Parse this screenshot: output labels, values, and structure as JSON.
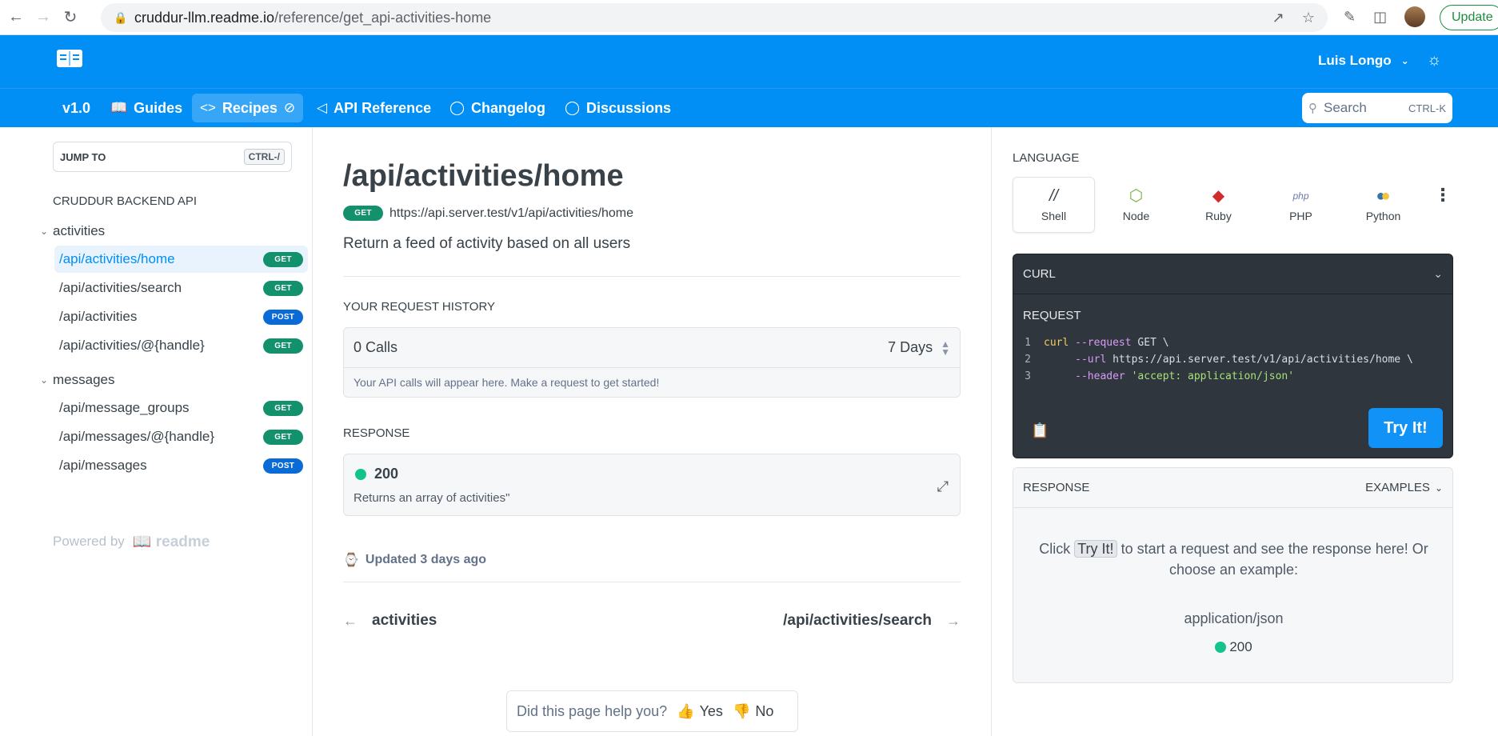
{
  "browser": {
    "url_host": "cruddur-llm.readme.io",
    "url_path": "/reference/get_api-activities-home",
    "update_label": "Update"
  },
  "header": {
    "user_name": "Luis Longo"
  },
  "nav": {
    "version": "v1.0",
    "items": [
      {
        "label": "Guides",
        "icon": "book-icon"
      },
      {
        "label": "Recipes",
        "icon": "code-icon"
      },
      {
        "label": "API Reference",
        "icon": "megaphone-icon"
      },
      {
        "label": "Changelog",
        "icon": "chat-icon"
      },
      {
        "label": "Discussions",
        "icon": "chat-icon"
      }
    ],
    "search_placeholder": "Search",
    "search_shortcut": "CTRL-K"
  },
  "sidebar": {
    "jump_to": "JUMP TO",
    "jump_shortcut": "CTRL-/",
    "title": "CRUDDUR BACKEND API",
    "sections": [
      {
        "name": "activities",
        "items": [
          {
            "label": "/api/activities/home",
            "method": "GET",
            "active": true
          },
          {
            "label": "/api/activities/search",
            "method": "GET"
          },
          {
            "label": "/api/activities",
            "method": "POST"
          },
          {
            "label": "/api/activities/@{handle}",
            "method": "GET"
          }
        ]
      },
      {
        "name": "messages",
        "items": [
          {
            "label": "/api/message_groups",
            "method": "GET"
          },
          {
            "label": "/api/messages/@{handle}",
            "method": "GET"
          },
          {
            "label": "/api/messages",
            "method": "POST"
          }
        ]
      }
    ],
    "powered_by": "Powered by",
    "powered_brand": "readme"
  },
  "main": {
    "title": "/api/activities/home",
    "method": "GET",
    "url": "https://api.server.test/v1/api/activities/home",
    "description": "Return a feed of activity based on all users",
    "history_label": "YOUR REQUEST HISTORY",
    "history_calls": "0 Calls",
    "history_range": "7 Days",
    "history_empty": "Your API calls will appear here. Make a request to get started!",
    "response_label": "RESPONSE",
    "response_code": "200",
    "response_desc": "Returns an array of activities\"",
    "updated": "Updated 3 days ago",
    "prev_label": "activities",
    "next_label": "/api/activities/search",
    "helpful_q": "Did this page help you?",
    "yes": "Yes",
    "no": "No"
  },
  "right": {
    "language_label": "LANGUAGE",
    "languages": [
      {
        "label": "Shell",
        "icon": "shell-icon",
        "active": true
      },
      {
        "label": "Node",
        "icon": "node-icon"
      },
      {
        "label": "Ruby",
        "icon": "ruby-icon"
      },
      {
        "label": "PHP",
        "icon": "php-icon"
      },
      {
        "label": "Python",
        "icon": "python-icon"
      }
    ],
    "curl_label": "CURL",
    "request_label": "REQUEST",
    "code_lines": [
      {
        "n": "1",
        "parts": [
          [
            "cmd",
            "curl"
          ],
          [
            "plain",
            " "
          ],
          [
            "flag",
            "--request"
          ],
          [
            "plain",
            " GET \\"
          ]
        ]
      },
      {
        "n": "2",
        "parts": [
          [
            "plain",
            "     "
          ],
          [
            "flag",
            "--url"
          ],
          [
            "plain",
            " https://api.server.test/v1/api/activities/home \\"
          ]
        ]
      },
      {
        "n": "3",
        "parts": [
          [
            "plain",
            "     "
          ],
          [
            "flag",
            "--header"
          ],
          [
            "plain",
            " "
          ],
          [
            "str",
            "'accept: application/json'"
          ]
        ]
      }
    ],
    "try_label": "Try It!",
    "response_label": "RESPONSE",
    "examples_label": "EXAMPLES",
    "msg_before": "Click",
    "msg_try": "Try It!",
    "msg_after": "to start a request and see the response here! Or choose an example:",
    "media_type": "application/json",
    "example_code": "200"
  },
  "colors": {
    "brand": "#018ef5",
    "get": "#12916c",
    "post": "#0b6bd6",
    "success": "#12c48b"
  }
}
